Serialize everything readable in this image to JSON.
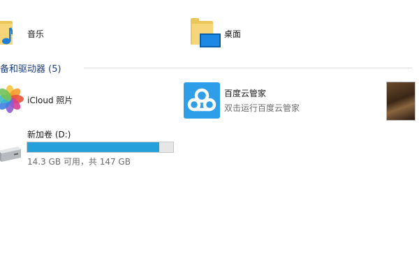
{
  "folders": [
    {
      "label": "音乐",
      "icon": "music-folder-icon"
    },
    {
      "label": "桌面",
      "icon": "desktop-folder-icon"
    }
  ],
  "section": {
    "title": "备和驱动器 (5)"
  },
  "devices": {
    "icloud": {
      "label": "iCloud 照片",
      "icon": "photos-icon"
    },
    "baidu": {
      "label": "百度云管家",
      "subtitle": "双击运行百度云管家",
      "icon": "baidu-cloud-icon"
    },
    "thumbnail": {
      "icon": "media-thumbnail-icon"
    },
    "drive": {
      "label": "新加卷 (D:)",
      "usage": "14.3 GB 可用，共 147 GB",
      "used_fraction": 0.903,
      "icon": "hard-drive-icon"
    }
  },
  "colors": {
    "accent": "#26a0da",
    "section_title": "#1d3f7a",
    "folder": "#f6d678",
    "baidu": "#2f9ee8"
  }
}
